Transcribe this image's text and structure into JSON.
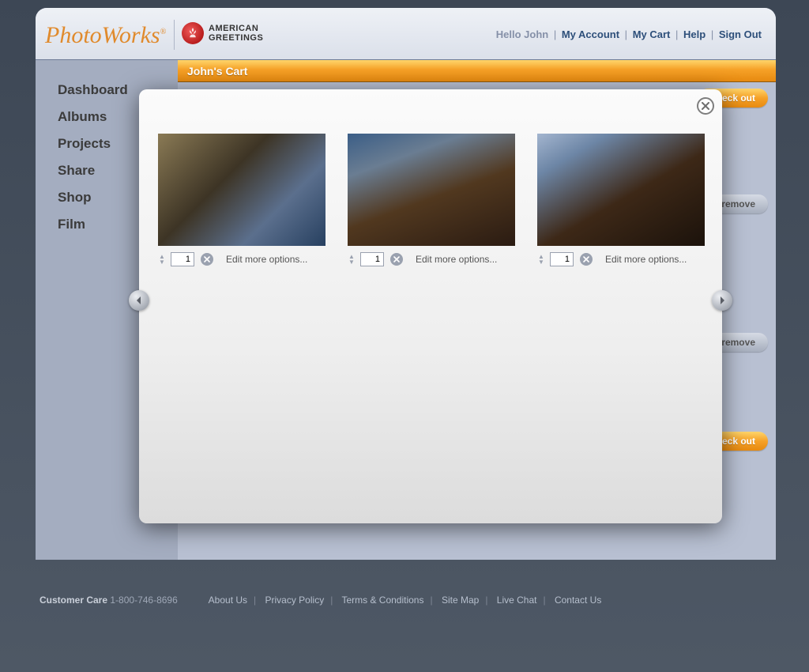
{
  "header": {
    "logo_text": "PhotoWorks",
    "logo_tm": "®",
    "partner_line1": "AMERICAN",
    "partner_line2": "GREETINGS",
    "hello": "Hello John",
    "links": {
      "my_account": "My Account",
      "my_cart": "My Cart",
      "help": "Help",
      "sign_out": "Sign Out"
    }
  },
  "sidebar": {
    "items": [
      {
        "label": "Dashboard"
      },
      {
        "label": "Albums"
      },
      {
        "label": "Projects"
      },
      {
        "label": "Share"
      },
      {
        "label": "Shop"
      },
      {
        "label": "Film"
      }
    ]
  },
  "cart": {
    "title": "John's Cart",
    "checkout_label": "check out",
    "remove_label": "remove"
  },
  "modal": {
    "close_label": "close",
    "edit_more_label": "Edit more options...",
    "photos": [
      {
        "qty": "1"
      },
      {
        "qty": "1"
      },
      {
        "qty": "1"
      }
    ]
  },
  "footer": {
    "care_label": "Customer Care",
    "care_phone": "1-800-746-8696",
    "links": {
      "about": "About Us",
      "privacy": "Privacy Policy",
      "terms": "Terms & Conditions",
      "sitemap": "Site Map",
      "livechat": "Live Chat",
      "contact": "Contact Us"
    }
  }
}
